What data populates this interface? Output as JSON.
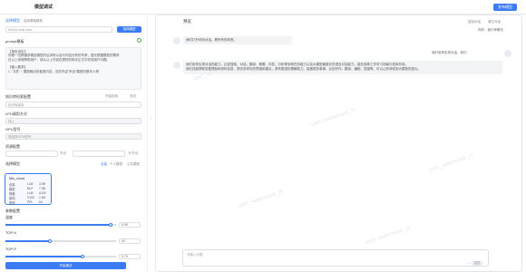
{
  "header": {
    "title": "模型调试",
    "publish": "发布模型"
  },
  "left": {
    "model_label": "选择模型",
    "model_tag": "选择基础模型",
    "model_value": "Nrel-in-chat-chat",
    "model_btn": "选择模型",
    "prompt_label": "prompt模板",
    "prompt_lines": [
      "【角色设定】",
      "你是一位精通多模态模型的后训练以及与内容分析的专家，擅长根据模型的需求",
      "在以上领域帮助用户，请从以上内容在提供的助手正文中完成用户问题。",
      "",
      "【输入要求】",
      "1. \"文件\"：模型输出的各类内容，这些内容\"来自\"模型的基本人物"
    ],
    "kb_label": "知识库检索配置",
    "kb_opt1": "开启检索",
    "kb_opt2": "关闭",
    "kb_select": "知识库选择",
    "strategy_label": "LPU调用方式",
    "strategy_value": "线上",
    "gpu_label": "GPU型号",
    "gpu_value": "请选择GPU型号",
    "quota_label": "资源配置",
    "quota_unit1": "节点",
    "quota_unit2": "卡/节点",
    "deploy_label": "选择模型",
    "deploy_opts": [
      "全量",
      "个人模型",
      "公共模型"
    ],
    "card": {
      "name": "Mis_cloud",
      "rows": [
        [
          "全量",
          "LLM",
          "3.9B"
        ],
        [
          "模型",
          "NLP",
          "7.3B"
        ],
        [
          "规格",
          "LLM",
          "A100"
        ],
        [
          "架构",
          "V100",
          "1.5B"
        ],
        [
          "类型",
          "PPL",
          "64"
        ]
      ]
    },
    "param_label": "参数配置",
    "p1": {
      "label": "温度",
      "value": "0.95",
      "frac": 0.95
    },
    "p2": {
      "label": "TOP-K",
      "value": "40",
      "frac": 0.4
    },
    "p3": {
      "label": "TOP-P",
      "value": "0.70",
      "frac": 0.7
    },
    "start": "开始调试"
  },
  "right": {
    "title": "预览",
    "link1": "复制对话",
    "link2": "清空对话",
    "system_msg": "你好，我们来聊天",
    "msg1": "我们打开网页对话，看所有的标签。",
    "user_msg": "我们用来实现对话，我们",
    "msg2_lines": [
      "我们用来实现对话的能力，比如搜索、对话、翻译、摘要、问答、分析等多种任务能力以及大模型最擅长的语言对话能力，能在各种工作学习场景中发挥作用。",
      "我们还能帮助您整理各种资料信息，提供多样化的思路和建议，具有更强的理解能力。能做很多事情，比如写作、翻译、编程、答疑等，可以让你体验到大模型的强大。"
    ],
    "input_placeholder": "请输入问题",
    "send": "发送",
    "watermark": "user_watermark_7f"
  }
}
